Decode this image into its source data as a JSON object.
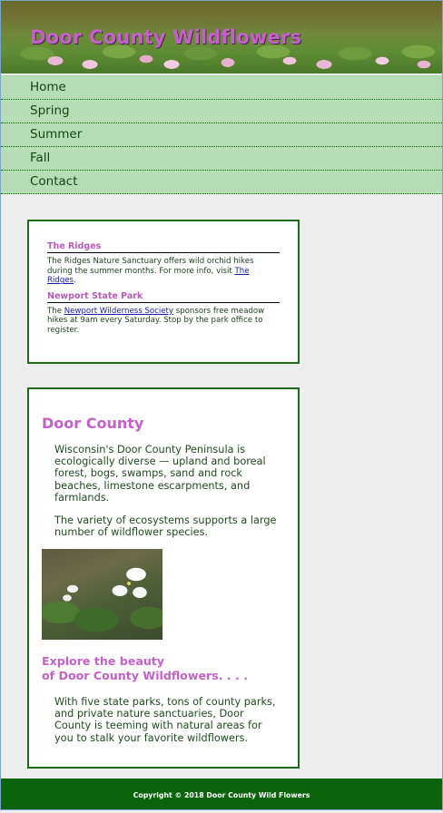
{
  "header": {
    "title": "Door County Wildflowers"
  },
  "nav": {
    "items": [
      {
        "label": "Home"
      },
      {
        "label": "Spring"
      },
      {
        "label": "Summer"
      },
      {
        "label": "Fall"
      },
      {
        "label": "Contact"
      }
    ]
  },
  "events": {
    "ridges": {
      "title": "The Ridges",
      "text_before": "The Ridges Nature Sanctuary offers wild orchid hikes during the summer months. For more info, visit ",
      "link": "The Ridges",
      "text_after": "."
    },
    "newport": {
      "title": "Newport State Park",
      "text_before": "The ",
      "link": "Newport Wilderness Society",
      "text_after": " sponsors free meadow hikes at 9am every Saturday. Stop by the park office to register."
    }
  },
  "main": {
    "heading": "Door County",
    "paragraph1": "Wisconsin's Door County Peninsula is ecologically diverse — upland and boreal forest, bogs, swamps, sand and rock beaches, limestone escarpments, and farmlands.",
    "paragraph2": "The variety of ecosystems supports a large number of wildflower species.",
    "explore_line1": "Explore the beauty",
    "explore_line2": "of Door County Wildflowers. . . .",
    "paragraph3": "With five state parks, tons of county parks, and private nature sanctuaries, Door County is teeming with natural areas for you to stalk your favorite wildflowers."
  },
  "footer": {
    "copyright": "Copyright © 2018 Door County Wild Flowers"
  },
  "colors": {
    "accent_pink": "#c55fc9",
    "nav_green": "#b6ddb6",
    "footer_green": "#0b630b",
    "border_green": "#1b6b1b"
  }
}
